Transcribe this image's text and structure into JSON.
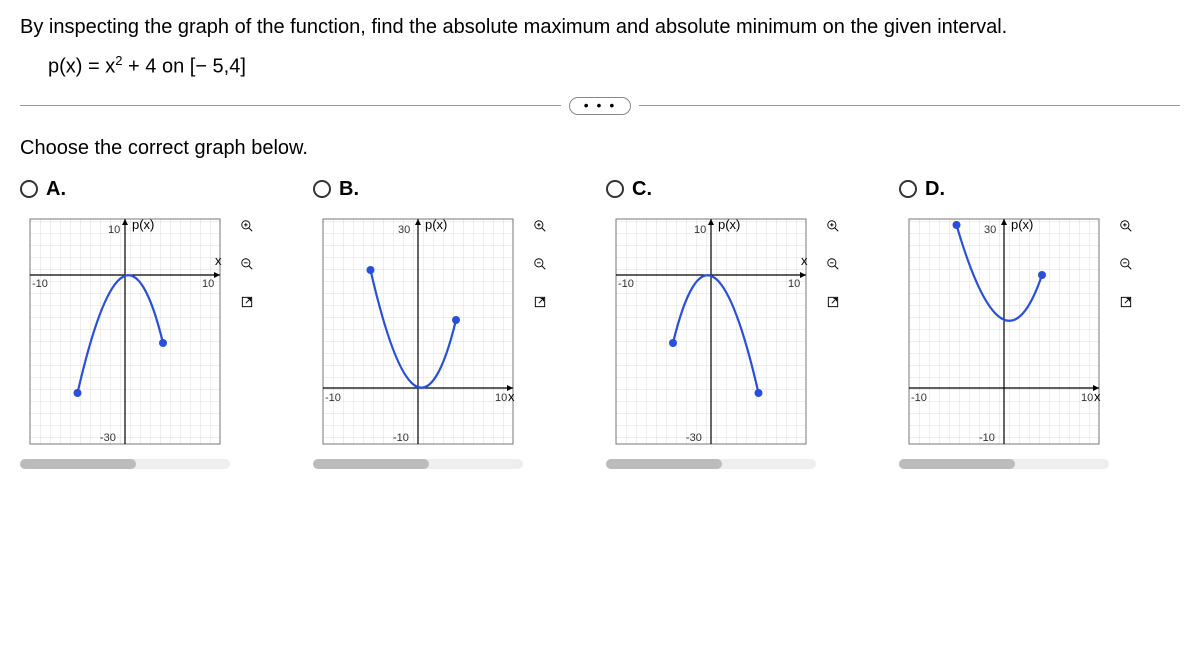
{
  "question": "By inspecting the graph of the function, find the absolute maximum and absolute minimum on the given interval.",
  "equation_prefix": "p(x) = x",
  "equation_exp": "2",
  "equation_suffix": " + 4 on [− 5,4]",
  "ellipsis": "• • •",
  "prompt": "Choose the correct graph below.",
  "options": {
    "a": {
      "label": "A."
    },
    "b": {
      "label": "B."
    },
    "c": {
      "label": "C."
    },
    "d": {
      "label": "D."
    }
  },
  "axis": {
    "y_label": "p(x)",
    "x_label": "x",
    "ticks_ac": {
      "y_top": "10",
      "y_bottom": "-30",
      "x_left": "-10",
      "x_right": "10"
    },
    "ticks_bd": {
      "y_top": "30",
      "y_bottom": "-10",
      "x_left": "-10",
      "x_right": "10"
    }
  },
  "chart_data": [
    {
      "option": "A",
      "type": "line",
      "xlim": [
        -10,
        10
      ],
      "ylim": [
        -30,
        10
      ],
      "xlabel": "x",
      "ylabel": "p(x)",
      "series": [
        {
          "name": "p(x)",
          "expr": "-(x^2)+4",
          "domain": [
            -5,
            4
          ]
        }
      ],
      "endpoints": [
        {
          "x": -5,
          "y": -21
        },
        {
          "x": 4,
          "y": -12
        }
      ]
    },
    {
      "option": "B",
      "type": "line",
      "xlim": [
        -10,
        10
      ],
      "ylim": [
        -10,
        30
      ],
      "xlabel": "x",
      "ylabel": "p(x)",
      "series": [
        {
          "name": "p(x)",
          "expr": "x^2-4",
          "domain": [
            -5,
            4
          ]
        }
      ],
      "endpoints": [
        {
          "x": -5,
          "y": 21
        },
        {
          "x": 4,
          "y": 12
        }
      ]
    },
    {
      "option": "C",
      "type": "line",
      "xlim": [
        -10,
        10
      ],
      "ylim": [
        -30,
        10
      ],
      "xlabel": "x",
      "ylabel": "p(x)",
      "series": [
        {
          "name": "p(x)",
          "expr": "-(x^2)+4",
          "domain": [
            -4,
            5
          ]
        }
      ],
      "endpoints": [
        {
          "x": -4,
          "y": -12
        },
        {
          "x": 5,
          "y": -21
        }
      ]
    },
    {
      "option": "D",
      "type": "line",
      "xlim": [
        -10,
        10
      ],
      "ylim": [
        -10,
        30
      ],
      "xlabel": "x",
      "ylabel": "p(x)",
      "series": [
        {
          "name": "p(x)",
          "expr": "x^2+4",
          "domain": [
            -5,
            4
          ]
        }
      ],
      "endpoints": [
        {
          "x": -5,
          "y": 29
        },
        {
          "x": 4,
          "y": 20
        }
      ]
    }
  ]
}
